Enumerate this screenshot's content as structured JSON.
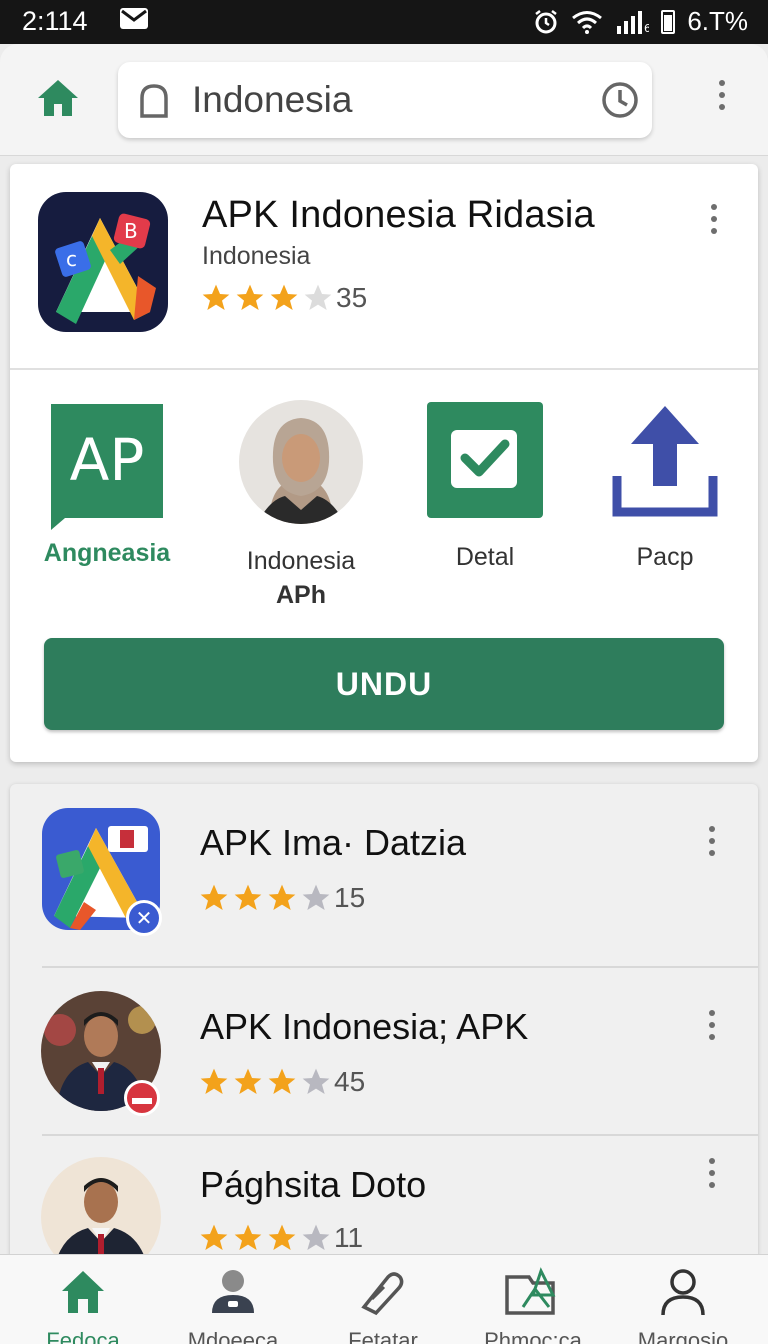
{
  "status_bar": {
    "time": "2:114",
    "battery_text": "6.T%",
    "icons": [
      "mail-icon",
      "alarm-icon",
      "wifi-icon",
      "signal-icon",
      "battery-icon"
    ]
  },
  "search": {
    "value": "Indonesia",
    "icons": [
      "home-icon",
      "lock-icon",
      "history-icon",
      "more-icon"
    ]
  },
  "main_card": {
    "title": "APK Indonesia Ridasia",
    "subtitle": "Indonesia",
    "rating_count": "35",
    "stars_filled": 3,
    "stars_total": 4,
    "actions": [
      {
        "icon": "ap-logo-icon",
        "label": "Angneasia"
      },
      {
        "icon": "user-photo",
        "label": "Indonesia",
        "sublabel": "APh"
      },
      {
        "icon": "checkbox-icon",
        "label": "Detal"
      },
      {
        "icon": "upload-icon",
        "label": "Pacp"
      }
    ],
    "install_button": "UNDU"
  },
  "list": [
    {
      "title": "APK Ima· Datzia",
      "rating_count": "15",
      "stars_filled": 3,
      "stars_total": 4
    },
    {
      "title": "APK Indonesia; APK",
      "rating_count": "45",
      "stars_filled": 3,
      "stars_total": 4
    },
    {
      "title": "Pághsita Doto",
      "rating_count": "11",
      "stars_filled": 3,
      "stars_total": 4
    }
  ],
  "bottom_nav": [
    {
      "label": "Fedoca",
      "icon": "home-icon",
      "active": true
    },
    {
      "label": "Mdoeeca",
      "icon": "person-icon",
      "active": false
    },
    {
      "label": "Fetatar",
      "icon": "edit-icon",
      "active": false
    },
    {
      "label": "Phmoc:ca",
      "icon": "folder-icon",
      "active": false
    },
    {
      "label": "Margosio",
      "icon": "profile-icon",
      "active": false
    }
  ],
  "colors": {
    "accent": "#2e7d5c",
    "star": "#f3a21b",
    "star_empty": "#c4c4c4",
    "status_bar": "#151515",
    "upload_blue": "#3f4fa8"
  }
}
